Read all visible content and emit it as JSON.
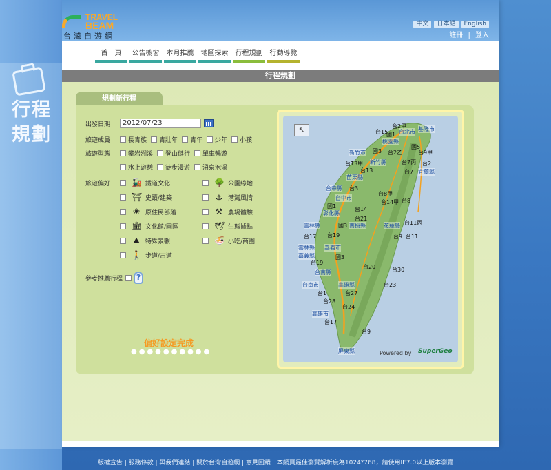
{
  "vertical_title": [
    "行程",
    "規劃"
  ],
  "logo": {
    "en_line1": "TRAVEL",
    "en_line2": "BEAM",
    "zh": "台灣自遊網"
  },
  "lang": [
    "中文",
    "日本語",
    "English"
  ],
  "auth": {
    "register": "註冊",
    "sep": "|",
    "login": "登入"
  },
  "nav": [
    "首　頁",
    "公告櫥窗",
    "本月推薦",
    "地圖探索",
    "行程規劃",
    "行動導覽"
  ],
  "page_title": "行程規劃",
  "tab_label": "規劃新行程",
  "form": {
    "date_label": "出發日期",
    "date_value": "2012/07/23",
    "members_label": "旅遊成員",
    "members": [
      "長青族",
      "青壯年",
      "青年",
      "少年",
      "小孩"
    ],
    "type_label": "旅遊型態",
    "types_row1": [
      "攀岩溯溪",
      "登山健行",
      "單車暢遊"
    ],
    "types_row2": [
      "水上遊憩",
      "徒步漫遊",
      "溫泉泡湯"
    ],
    "pref_label": "旅遊偏好",
    "prefs": [
      {
        "icon": "train-icon",
        "glyph": "🚂",
        "label": "鐵道文化"
      },
      {
        "icon": "tree-icon",
        "glyph": "🌳",
        "label": "公園綠地"
      },
      {
        "icon": "gate-icon",
        "glyph": "⛩",
        "label": "史蹟/建築"
      },
      {
        "icon": "anchor-icon",
        "glyph": "⚓",
        "label": "港灣風情"
      },
      {
        "icon": "tribe-icon",
        "glyph": "❀",
        "label": "原住民部落"
      },
      {
        "icon": "farm-icon",
        "glyph": "⚒",
        "label": "農場體驗"
      },
      {
        "icon": "museum-icon",
        "glyph": "🏛",
        "label": "文化館/園區"
      },
      {
        "icon": "bird-icon",
        "glyph": "🕊",
        "label": "生態據點"
      },
      {
        "icon": "landscape-icon",
        "glyph": "⛰",
        "label": "特殊景觀"
      },
      {
        "icon": "food-icon",
        "glyph": "🍜",
        "label": "小吃/商圈"
      },
      {
        "icon": "hiker-icon",
        "glyph": "🚶",
        "label": "步道/古道"
      }
    ],
    "recommend_label": "參考推薦行程",
    "done_label": "偏好設定完成",
    "dots": "●●●●●●●●●●"
  },
  "map": {
    "powered": "Powered by",
    "brand": "SuperGeo",
    "labels": [
      {
        "t": "台2甲",
        "c": false
      },
      {
        "t": "台15",
        "c": false
      },
      {
        "t": "國1",
        "c": false
      },
      {
        "t": "台北市",
        "c": true
      },
      {
        "t": "基隆市",
        "c": true
      },
      {
        "t": "桃園縣",
        "c": true
      },
      {
        "t": "國5",
        "c": false
      },
      {
        "t": "新竹市",
        "c": true
      },
      {
        "t": "國3",
        "c": false
      },
      {
        "t": "台2乙",
        "c": false
      },
      {
        "t": "台9甲",
        "c": false
      },
      {
        "t": "新竹縣",
        "c": true
      },
      {
        "t": "台7丙",
        "c": false
      },
      {
        "t": "台13甲",
        "c": false
      },
      {
        "t": "台13",
        "c": false
      },
      {
        "t": "台2",
        "c": false
      },
      {
        "t": "苗栗縣",
        "c": true
      },
      {
        "t": "台7",
        "c": false
      },
      {
        "t": "宜蘭縣",
        "c": true
      },
      {
        "t": "台中縣",
        "c": true
      },
      {
        "t": "台3",
        "c": false
      },
      {
        "t": "台8甲",
        "c": false
      },
      {
        "t": "台中市",
        "c": true
      },
      {
        "t": "台14甲",
        "c": false
      },
      {
        "t": "台8",
        "c": false
      },
      {
        "t": "國1",
        "c": false
      },
      {
        "t": "彰化縣",
        "c": true
      },
      {
        "t": "台14",
        "c": false
      },
      {
        "t": "台21",
        "c": false
      },
      {
        "t": "台11丙",
        "c": false
      },
      {
        "t": "雲林縣",
        "c": true
      },
      {
        "t": "國3",
        "c": false
      },
      {
        "t": "南投縣",
        "c": true
      },
      {
        "t": "花蓮縣",
        "c": true
      },
      {
        "t": "台17",
        "c": false
      },
      {
        "t": "台19",
        "c": false
      },
      {
        "t": "台9",
        "c": false
      },
      {
        "t": "台11",
        "c": false
      },
      {
        "t": "雲林縣",
        "c": true
      },
      {
        "t": "嘉義市",
        "c": true
      },
      {
        "t": "嘉義縣",
        "c": true
      },
      {
        "t": "國3",
        "c": false
      },
      {
        "t": "台19",
        "c": false
      },
      {
        "t": "台20",
        "c": false
      },
      {
        "t": "台南縣",
        "c": true
      },
      {
        "t": "台30",
        "c": false
      },
      {
        "t": "台南市",
        "c": true
      },
      {
        "t": "高雄縣",
        "c": true
      },
      {
        "t": "台23",
        "c": false
      },
      {
        "t": "台1",
        "c": false
      },
      {
        "t": "台27",
        "c": false
      },
      {
        "t": "台28",
        "c": false
      },
      {
        "t": "台24",
        "c": false
      },
      {
        "t": "高雄市",
        "c": true
      },
      {
        "t": "台17",
        "c": false
      },
      {
        "t": "台9",
        "c": false
      },
      {
        "t": "屏東縣",
        "c": true
      }
    ]
  },
  "footer": "版權宣告 | 服務條款 | 與我們連結 | 關於台灣自遊網 | 意見回饋　本網頁最佳瀏覽解析度為1024*768，請使用IE7.0以上版本瀏覽"
}
